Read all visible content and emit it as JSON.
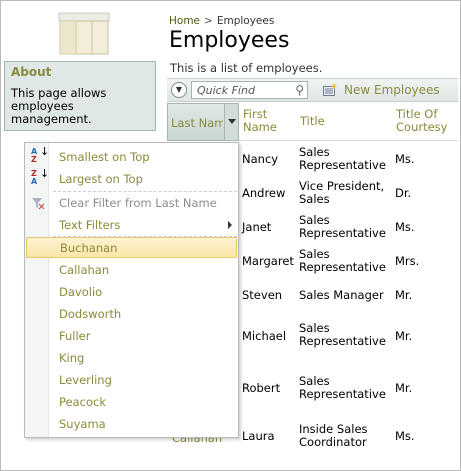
{
  "breadcrumb": {
    "home": "Home",
    "separator": ">",
    "current": "Employees"
  },
  "page": {
    "title": "Employees",
    "description": "This is a list of employees."
  },
  "about": {
    "title": "About",
    "text": "This page allows employees management."
  },
  "actionbar": {
    "quick_find_placeholder": "Quick Find",
    "new_label": "New Employees"
  },
  "grid": {
    "columns": [
      "Last Nam",
      "First Name",
      "Title",
      "Title Of Courtesy"
    ],
    "rows": [
      {
        "first": "Nancy",
        "title": "Sales Representative",
        "courtesy": "Ms."
      },
      {
        "first": "Andrew",
        "title": "Vice President, Sales",
        "courtesy": "Dr."
      },
      {
        "first": "Janet",
        "title": "Sales Representative",
        "courtesy": "Ms."
      },
      {
        "first": "Margaret",
        "title": "Sales Representative",
        "courtesy": "Mrs."
      },
      {
        "first": "Steven",
        "title": "Sales Manager",
        "courtesy": "Mr."
      },
      {
        "first": "Michael",
        "title": "Sales Representative",
        "courtesy": "Mr."
      },
      {
        "first": "Robert",
        "title": "Sales Representative",
        "courtesy": "Mr."
      },
      {
        "first": "Laura",
        "title": "Inside Sales Coordinator",
        "courtesy": "Ms."
      }
    ],
    "last_row_lastname": "Callahan"
  },
  "menu": {
    "sort_asc": "Smallest on Top",
    "sort_desc": "Largest on Top",
    "clear_filter": "Clear Filter from Last Name",
    "text_filters": "Text Filters",
    "values": [
      "Buchanan",
      "Callahan",
      "Davolio",
      "Dodsworth",
      "Fuller",
      "King",
      "Leverling",
      "Peacock",
      "Suyama"
    ],
    "selected": "Buchanan"
  },
  "icons": {
    "sort_asc": "sort-ascending-icon",
    "sort_desc": "sort-descending-icon",
    "clear_filter": "clear-filter-icon",
    "search": "search-icon",
    "new": "new-record-icon",
    "chevron": "chevron-down-icon"
  },
  "colors": {
    "accent_text": "#8a8a3a",
    "selected_bg": "#fbe6a8",
    "panel_bg": "#dfe8e6"
  }
}
